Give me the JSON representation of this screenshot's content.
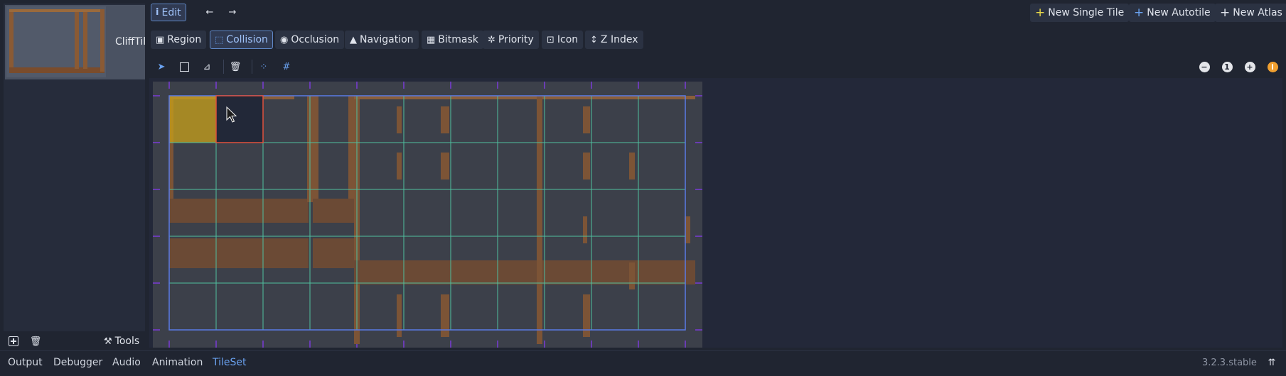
{
  "tileset_list": {
    "items": [
      {
        "label": "CliffTiles.png"
      }
    ],
    "bottom": {
      "add_icon": "plus-box-icon",
      "remove_icon": "trash-icon",
      "tools_label": "Tools"
    }
  },
  "top_toolbar": {
    "edit_label": "Edit",
    "back_icon": "arrow-left-icon",
    "forward_icon": "arrow-right-icon",
    "new_single_tile": "New Single Tile",
    "new_autotile": "New Autotile",
    "new_atlas": "New Atlas"
  },
  "mode_tabs": [
    {
      "label": "Region",
      "icon": "region-icon",
      "active": false
    },
    {
      "label": "Collision",
      "icon": "collision-icon",
      "active": true
    },
    {
      "label": "Occlusion",
      "icon": "occlusion-icon",
      "active": false
    },
    {
      "label": "Navigation",
      "icon": "navigation-icon",
      "active": false
    },
    {
      "label": "Bitmask",
      "icon": "bitmask-icon",
      "active": false
    },
    {
      "label": "Priority",
      "icon": "priority-icon",
      "active": false
    },
    {
      "label": "Icon",
      "icon": "icon-mode-icon",
      "active": false
    },
    {
      "label": "Z Index",
      "icon": "zindex-icon",
      "active": false
    }
  ],
  "tool_strip": {
    "tools": [
      "select-icon",
      "rectangle-icon",
      "polygon-icon",
      "delete-icon",
      "keep-inside-icon",
      "grid-snap-icon"
    ],
    "zoom": {
      "zoom_out": "zoom-out-icon",
      "zoom_reset_label": "1",
      "zoom_in": "zoom-in-icon",
      "info": "info-icon"
    }
  },
  "tile_grid": {
    "columns": 11,
    "rows": 5,
    "selected_cell": [
      1,
      0
    ],
    "highlighted_cell": [
      0,
      0
    ]
  },
  "bottom_panel": {
    "tabs": [
      "Output",
      "Debugger",
      "Audio",
      "Animation",
      "TileSet"
    ],
    "active_tab": "TileSet",
    "version": "3.2.3.stable",
    "collapse_icon": "collapse-panel-icon"
  },
  "colors": {
    "accent": "#6aa2f0",
    "grid_line": "#4fbf9f",
    "grid_border": "#5a7ae6",
    "selection": "#e0503c",
    "highlight": "#c8a019"
  }
}
